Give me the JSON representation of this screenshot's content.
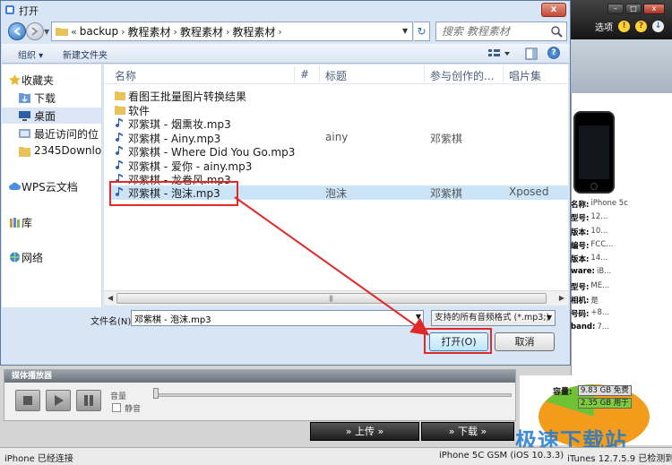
{
  "dialog": {
    "title": "打开",
    "close_label": "x"
  },
  "address": {
    "prefix": "«",
    "crumbs": [
      "backup",
      "教程素材",
      "教程素材",
      "教程素材"
    ]
  },
  "search": {
    "placeholder": "搜索 教程素材"
  },
  "toolbar": {
    "organize": "组织 ▾",
    "new_folder": "新建文件夹",
    "help": "?"
  },
  "nav_pane": {
    "favorites": "收藏夹",
    "items": [
      "下载",
      "桌面",
      "最近访问的位",
      "2345Downlo"
    ],
    "wps": "WPS云文档",
    "library": "库",
    "network": "网络"
  },
  "columns": [
    "名称",
    "#",
    "标题",
    "参与创作的...",
    "唱片集"
  ],
  "files": [
    {
      "name": "看图王批量图片转换结果",
      "type": "folder",
      "title": "",
      "artist": "",
      "album": ""
    },
    {
      "name": "软件",
      "type": "folder",
      "title": "",
      "artist": "",
      "album": ""
    },
    {
      "name": "邓紫琪 - 烟熏妆.mp3",
      "type": "audio",
      "title": "",
      "artist": "",
      "album": ""
    },
    {
      "name": "邓紫棋 - Ainy.mp3",
      "type": "audio",
      "title": "ainy",
      "artist": "邓紫棋",
      "album": ""
    },
    {
      "name": "邓紫棋 - Where Did You Go.mp3",
      "type": "audio",
      "title": "",
      "artist": "",
      "album": ""
    },
    {
      "name": "邓紫棋 - 爱你 - ainy.mp3",
      "type": "audio",
      "title": "",
      "artist": "",
      "album": ""
    },
    {
      "name": "邓紫棋 - 龙卷风.mp3",
      "type": "audio",
      "title": "",
      "artist": "",
      "album": ""
    },
    {
      "name": "邓紫棋 - 泡沫.mp3",
      "type": "audio",
      "title": "泡沫",
      "artist": "邓紫棋",
      "album": "Xposed",
      "selected": true
    }
  ],
  "filename": {
    "label": "文件名(N):",
    "value": "邓紫棋 - 泡沫.mp3"
  },
  "filetype": {
    "value": "支持的所有音频格式 (*.mp3;)"
  },
  "buttons": {
    "open": "打开(O)",
    "cancel": "取消"
  },
  "app": {
    "options_label": "选项",
    "media_title": "媒体播放器",
    "volume_label": "音量",
    "mute_label": "静音",
    "upload": "» 上传 »",
    "download": "» 下载 »",
    "status_left": "iPhone 已经连接",
    "status_device": "iPhone 5C GSM (iOS 10.3.3)",
    "status_itunes": "iTunes 12.7.5.9 已检测到",
    "device_info": [
      {
        "k": "名称:",
        "v": "iPhone 5c"
      },
      {
        "k": "型号:",
        "v": "12..."
      },
      {
        "k": "版本:",
        "v": "10..."
      },
      {
        "k": "编号:",
        "v": "FCC..."
      },
      {
        "k": "版本:",
        "v": "14..."
      },
      {
        "k": "ware:",
        "v": "iB..."
      },
      {
        "k": "型号:",
        "v": "ME..."
      },
      {
        "k": "相机:",
        "v": "是"
      },
      {
        "k": "号码:",
        "v": "+8..."
      },
      {
        "k": "band:",
        "v": "7..."
      }
    ],
    "capacity_label": "容量:",
    "capacity_free": "9.83 GB 免费",
    "capacity_used": "2.35 GB 用于",
    "watermark": "极速下载站"
  },
  "colors": {
    "highlight": "#e02a2a",
    "selection": "#cce4f7",
    "accent": "#2c6fbe"
  }
}
